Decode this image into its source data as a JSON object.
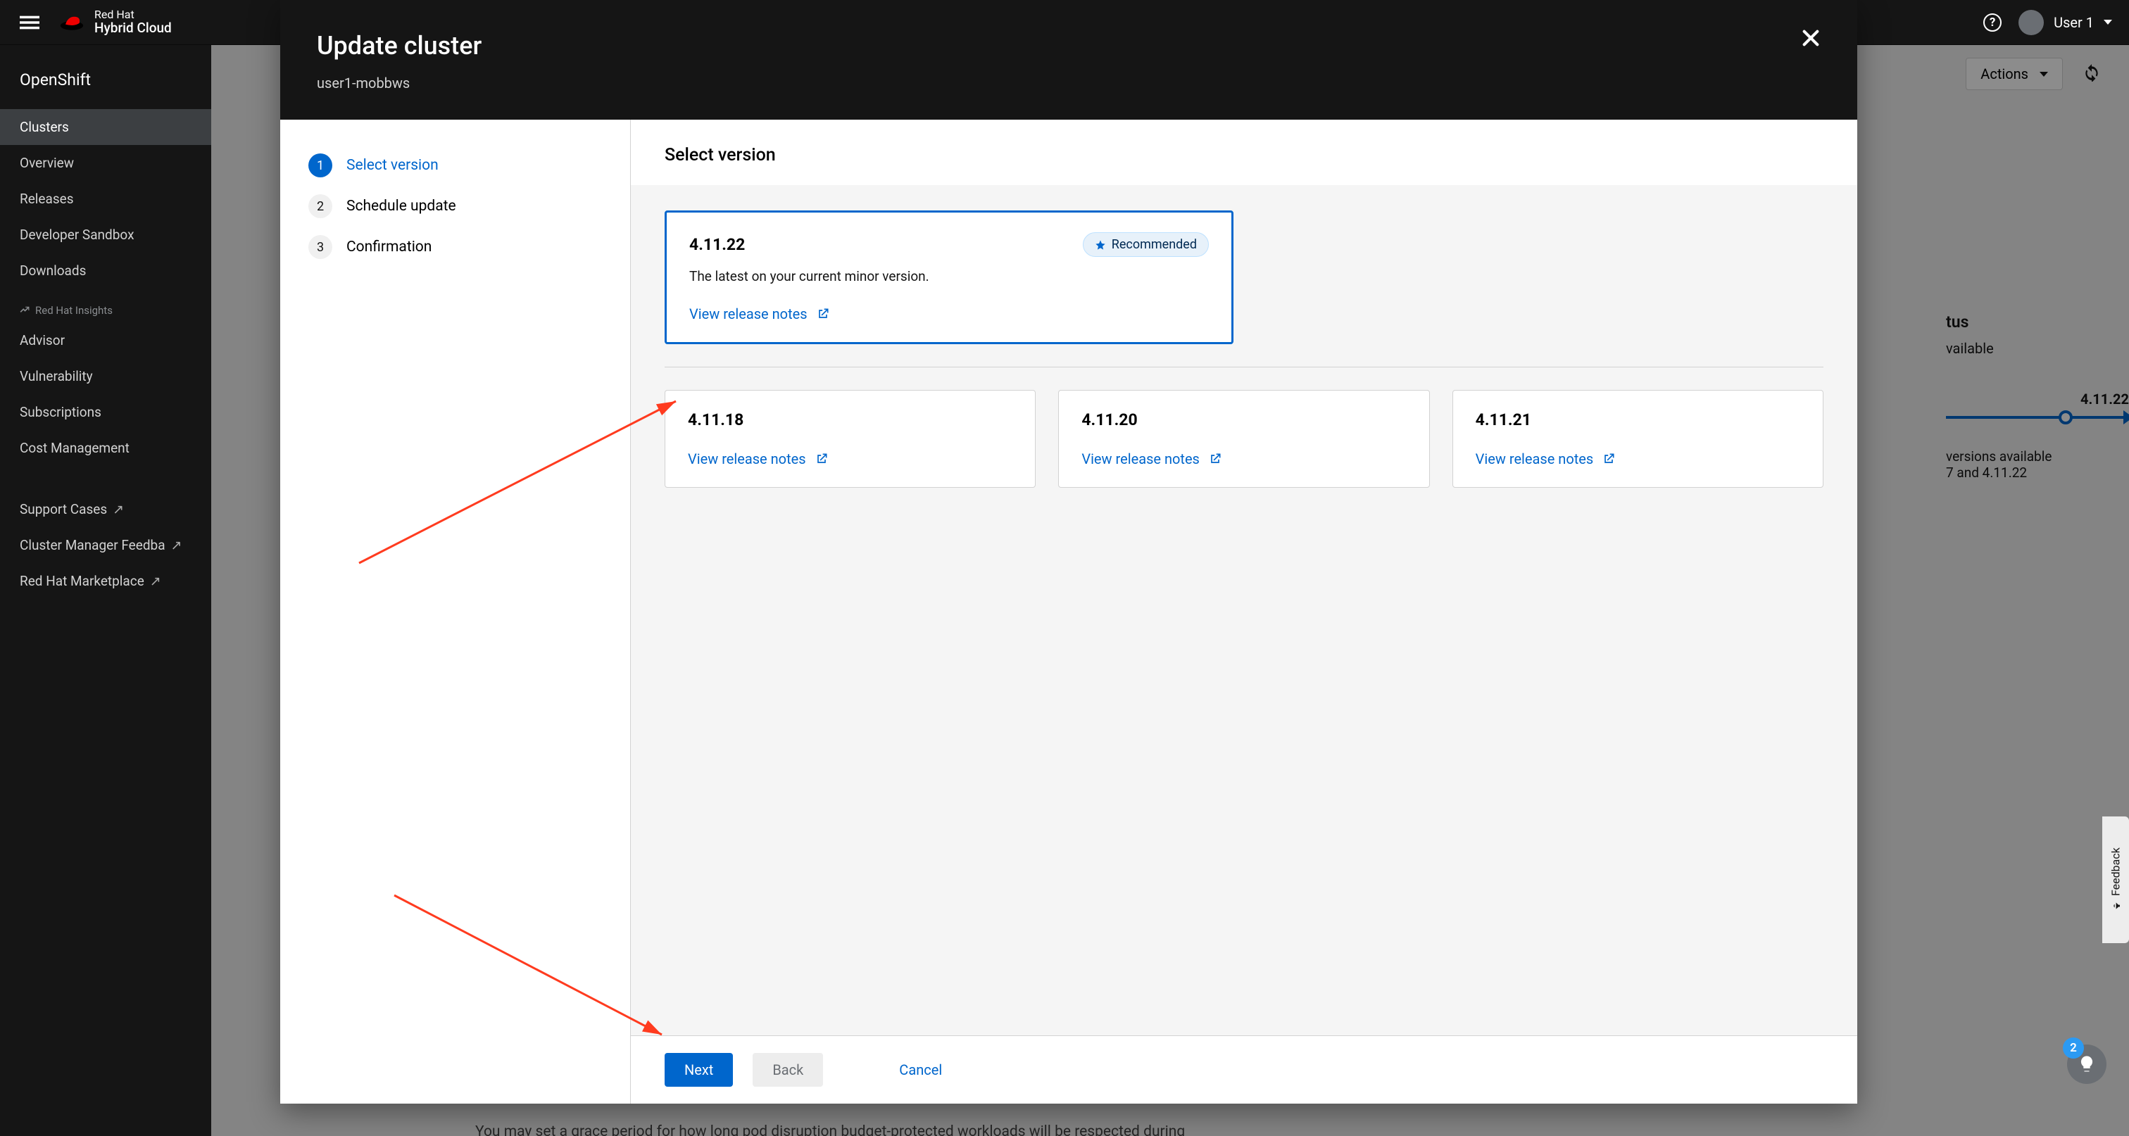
{
  "masthead": {
    "brand_line1": "Red Hat",
    "brand_line2": "Hybrid Cloud",
    "user_name": "User 1"
  },
  "sidebar": {
    "product": "OpenShift",
    "items": [
      {
        "label": "Clusters",
        "active": true
      },
      {
        "label": "Overview"
      },
      {
        "label": "Releases"
      },
      {
        "label": "Developer Sandbox"
      },
      {
        "label": "Downloads"
      }
    ],
    "section": "Red Hat Insights",
    "insights_items": [
      {
        "label": "Advisor"
      },
      {
        "label": "Vulnerability"
      },
      {
        "label": "Subscriptions"
      },
      {
        "label": "Cost Management"
      }
    ],
    "support_items": [
      {
        "label": "Support Cases",
        "ext": true
      },
      {
        "label": "Cluster Manager Feedba",
        "ext": true
      },
      {
        "label": "Red Hat Marketplace",
        "ext": true
      }
    ]
  },
  "page": {
    "actions_label": "Actions",
    "status_heading": "tus",
    "status_value": "vailable",
    "track_version": "4.11.22",
    "versions_note_line1": "versions available",
    "versions_note_line2": "7 and 4.11.22",
    "lower_text": "You may set a grace period for how long pod disruption budget-protected workloads will be respected during"
  },
  "modal": {
    "title": "Update cluster",
    "subtitle": "user1-mobbws",
    "steps": [
      {
        "num": "1",
        "label": "Select version",
        "active": true
      },
      {
        "num": "2",
        "label": "Schedule update"
      },
      {
        "num": "3",
        "label": "Confirmation"
      }
    ],
    "panel_title": "Select version",
    "recommended_badge": "Recommended",
    "selected_version": {
      "version": "4.11.22",
      "desc": "The latest on your current minor version.",
      "link": "View release notes"
    },
    "other_versions": [
      {
        "version": "4.11.18",
        "link": "View release notes"
      },
      {
        "version": "4.11.20",
        "link": "View release notes"
      },
      {
        "version": "4.11.21",
        "link": "View release notes"
      }
    ],
    "footer": {
      "next": "Next",
      "back": "Back",
      "cancel": "Cancel"
    }
  },
  "feedback": {
    "tab": "Feedback",
    "badge": "2"
  }
}
